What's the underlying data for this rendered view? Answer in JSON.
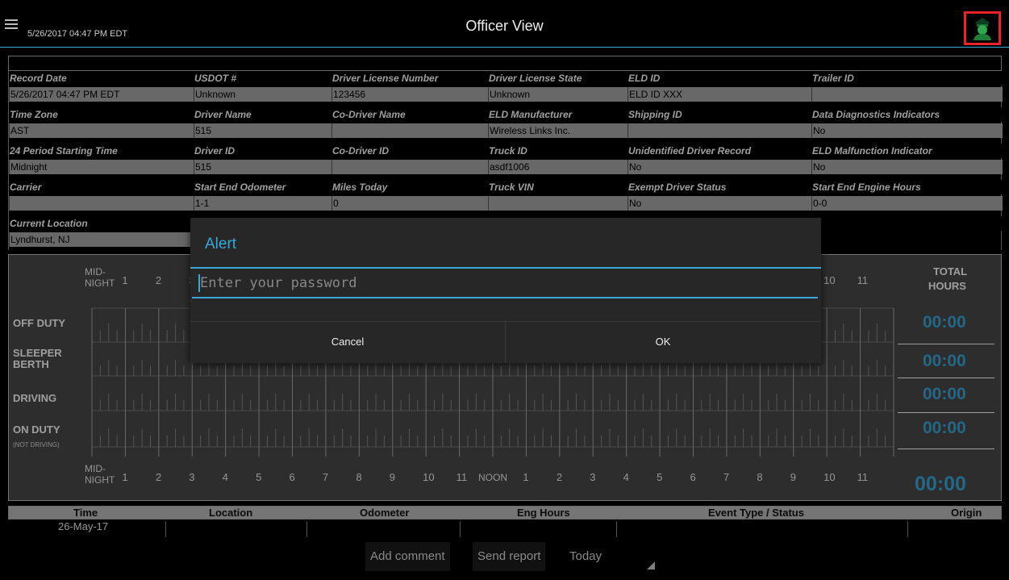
{
  "topbar": {
    "date": "5/26/2017 04:47 PM EDT",
    "title": "Officer View",
    "menu_icon": "hamburger-icon",
    "officer_icon": "officer-icon"
  },
  "info_rows": [
    {
      "labels": [
        "Record Date",
        "USDOT #",
        "Driver License Number",
        "Driver License State",
        "ELD ID",
        "Trailer ID"
      ],
      "values": [
        "5/26/2017 04:47 PM EDT",
        "Unknown",
        "123456",
        "Unknown",
        "ELD ID XXX",
        ""
      ]
    },
    {
      "labels": [
        "Time Zone",
        "Driver Name",
        "Co-Driver Name",
        "ELD Manufacturer",
        "Shipping ID",
        "Data Diagnostics Indicators"
      ],
      "values": [
        "AST",
        "515",
        "",
        "Wireless Links Inc.",
        "",
        "No"
      ]
    },
    {
      "labels": [
        "24 Period Starting Time",
        "Driver ID",
        "Co-Driver ID",
        "Truck ID",
        "Unidentified Driver Record",
        "ELD Malfunction Indicator"
      ],
      "values": [
        "Midnight",
        "515",
        "",
        "asdf1006",
        "No",
        "No"
      ]
    },
    {
      "labels": [
        "Carrier",
        "Start End Odometer",
        "Miles Today",
        "Truck VIN",
        "Exempt Driver Status",
        "Start End Engine Hours"
      ],
      "values": [
        "",
        "1-1",
        "0",
        "",
        "No",
        "0-0"
      ]
    },
    {
      "labels": [
        "Current Location",
        "",
        "",
        "",
        "",
        ""
      ],
      "values": [
        "Lyndhurst, NJ",
        "",
        "",
        "",
        "",
        ""
      ]
    }
  ],
  "chart": {
    "mid": "MID-",
    "night": "NIGHT",
    "noon": "NOON",
    "hours_am": [
      "1",
      "2",
      "3",
      "4",
      "5",
      "6",
      "7",
      "8",
      "9",
      "10",
      "11"
    ],
    "hours_pm": [
      "1",
      "2",
      "3",
      "4",
      "5",
      "6",
      "7",
      "8",
      "9",
      "10",
      "11"
    ],
    "total_label_1": "TOTAL",
    "total_label_2": "HOURS",
    "statuses": [
      {
        "label": "OFF DUTY",
        "sub": "",
        "total": "00:00"
      },
      {
        "label": "SLEEPER BERTH",
        "sub": "",
        "total": "00:00"
      },
      {
        "label": "DRIVING",
        "sub": "",
        "total": "00:00"
      },
      {
        "label": "ON DUTY",
        "sub": "(NOT DRIVING)",
        "total": "00:00"
      }
    ],
    "grand_total": "00:00"
  },
  "alert": {
    "title": "Alert",
    "placeholder": "Enter your password",
    "cancel": "Cancel",
    "ok": "OK"
  },
  "table": {
    "headers": [
      "Time",
      "Location",
      "Odometer",
      "Eng Hours",
      "Event Type / Status",
      "Origin"
    ],
    "rows": [
      [
        "26-May-17"
      ]
    ]
  },
  "bottom": {
    "add_comment": "Add comment",
    "send_report": "Send report",
    "period": "Today"
  }
}
